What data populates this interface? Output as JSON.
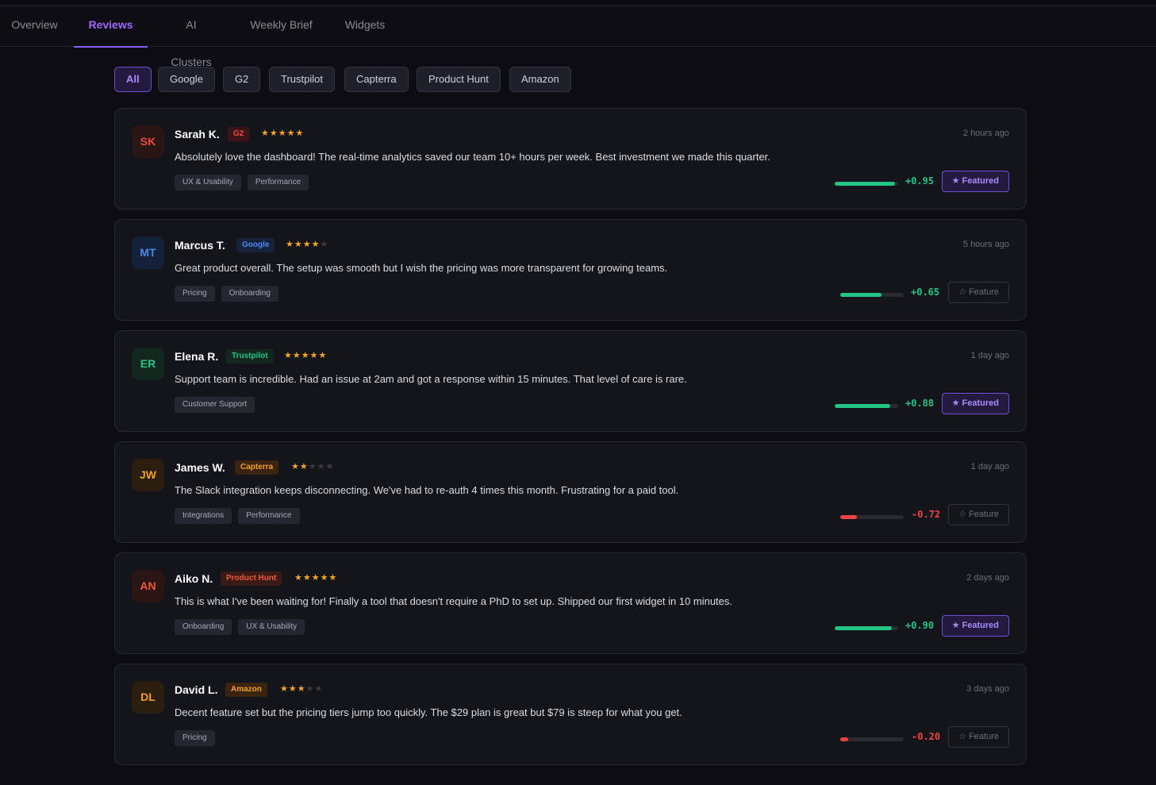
{
  "tabs": [
    {
      "label": "Overview"
    },
    {
      "label": "Reviews"
    },
    {
      "label": "AI Clusters"
    },
    {
      "label": "Weekly Brief"
    },
    {
      "label": "Widgets"
    }
  ],
  "active_tab": "Reviews",
  "filters": [
    {
      "label": "All"
    },
    {
      "label": "Google"
    },
    {
      "label": "G2"
    },
    {
      "label": "Trustpilot"
    },
    {
      "label": "Capterra"
    },
    {
      "label": "Product Hunt"
    },
    {
      "label": "Amazon"
    }
  ],
  "active_filter": "All",
  "colors": {
    "accent": "#8b5cf6",
    "positive": "#22c583",
    "negative": "#ef4444",
    "star": "#f5a524"
  },
  "reviews": [
    {
      "initials": "SK",
      "name": "Sarah K.",
      "source": "G2",
      "rating": 5,
      "time": "2 hours ago",
      "text": "Absolutely love the dashboard! The real-time analytics saved our team 10+ hours per week. Best investment we made this quarter.",
      "tags": [
        "UX & Usability",
        "Performance"
      ],
      "sentiment": 0.95,
      "sentiment_label": "+0.95",
      "featured": true,
      "feature_label": "★ Featured"
    },
    {
      "initials": "MT",
      "name": "Marcus T.",
      "source": "Google",
      "rating": 4,
      "time": "5 hours ago",
      "text": "Great product overall. The setup was smooth but I wish the pricing was more transparent for growing teams.",
      "tags": [
        "Pricing",
        "Onboarding"
      ],
      "sentiment": 0.65,
      "sentiment_label": "+0.65",
      "featured": false,
      "feature_label": "☆ Feature"
    },
    {
      "initials": "ER",
      "name": "Elena R.",
      "source": "Trustpilot",
      "rating": 5,
      "time": "1 day ago",
      "text": "Support team is incredible. Had an issue at 2am and got a response within 15 minutes. That level of care is rare.",
      "tags": [
        "Customer Support"
      ],
      "sentiment": 0.88,
      "sentiment_label": "+0.88",
      "featured": true,
      "feature_label": "★ Featured"
    },
    {
      "initials": "JW",
      "name": "James W.",
      "source": "Capterra",
      "rating": 2,
      "time": "1 day ago",
      "text": "The Slack integration keeps disconnecting. We've had to re-auth 4 times this month. Frustrating for a paid tool.",
      "tags": [
        "Integrations",
        "Performance"
      ],
      "sentiment": -0.72,
      "sentiment_label": "-0.72",
      "featured": false,
      "feature_label": "☆ Feature"
    },
    {
      "initials": "AN",
      "name": "Aiko N.",
      "source": "Product Hunt",
      "rating": 5,
      "time": "2 days ago",
      "text": "This is what I've been waiting for! Finally a tool that doesn't require a PhD to set up. Shipped our first widget in 10 minutes.",
      "tags": [
        "Onboarding",
        "UX & Usability"
      ],
      "sentiment": 0.9,
      "sentiment_label": "+0.90",
      "featured": true,
      "feature_label": "★ Featured"
    },
    {
      "initials": "DL",
      "name": "David L.",
      "source": "Amazon",
      "rating": 3,
      "time": "3 days ago",
      "text": "Decent feature set but the pricing tiers jump too quickly. The $29 plan is great but $79 is steep for what you get.",
      "tags": [
        "Pricing"
      ],
      "sentiment": -0.2,
      "sentiment_label": "-0.20",
      "featured": false,
      "feature_label": "☆ Feature"
    }
  ]
}
